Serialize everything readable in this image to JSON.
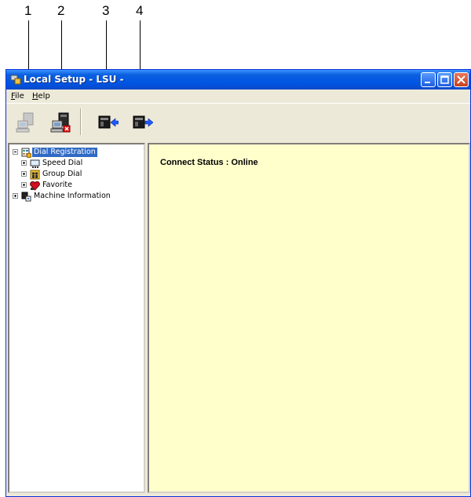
{
  "callouts": [
    "1",
    "2",
    "3",
    "4"
  ],
  "window": {
    "title": "Local Setup - LSU -",
    "controls": [
      "minimize",
      "maximize",
      "close"
    ]
  },
  "menu": {
    "file": {
      "accel": "F",
      "rest": "ile"
    },
    "help": {
      "accel": "H",
      "rest": "elp"
    }
  },
  "toolbar": {
    "buttons": [
      {
        "icon": "connect-computer-icon",
        "enabled": false
      },
      {
        "icon": "disconnect-computer-icon",
        "enabled": true
      },
      {
        "icon": "receive-data-icon",
        "enabled": true
      },
      {
        "icon": "send-data-icon",
        "enabled": true
      }
    ]
  },
  "tree": {
    "root": "Dial Registration",
    "children": [
      "Speed Dial",
      "Group Dial",
      "Favorite"
    ],
    "machine": "Machine Information"
  },
  "content": {
    "status": "Connect Status : Online"
  },
  "colors": {
    "titlebar": "#0054e3",
    "content_bg": "#ffffcc",
    "selection": "#316ac5"
  }
}
